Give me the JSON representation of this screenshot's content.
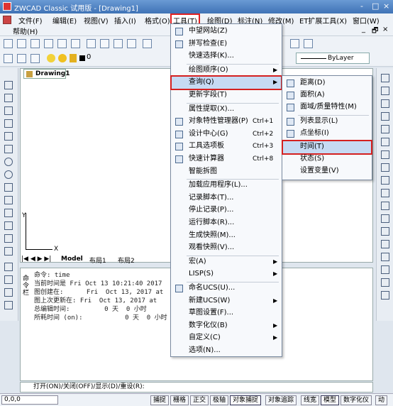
{
  "title": "ZWCAD Classic 试用版 - [Drawing1]",
  "window_controls": [
    "-",
    "□",
    "×"
  ],
  "doc_controls": [
    "_",
    "🗗",
    "×"
  ],
  "menubar": {
    "items": [
      "文件(F)",
      "编辑(E)",
      "视图(V)",
      "插入(I)",
      "格式(O)",
      "工具(T)",
      "绘图(D)",
      "标注(N)",
      "修改(M)",
      "ET扩展工具(X)",
      "窗口(W)"
    ],
    "help": "帮助(H)"
  },
  "bylayer": "ByLayer",
  "layer_value": "0",
  "doc_tab": "Drawing1",
  "model_tabs": [
    "Model",
    "布局1",
    "布局2"
  ],
  "command_history": [
    "命令: time",
    "当前时间是 Fri Oct 13 10:21:40 2017",
    "图创建在:      Fri  Oct 13, 2017 at",
    "图上次更新在: Fri  Oct 13, 2017 at",
    "总编辑时间:         0 天  0 小时",
    "所耗时间 (on):           0 天  0 小时"
  ],
  "command_side_label": "命\n令\n栏",
  "command_prompt": "打开(ON)/关闭(OFF)/显示(D)/重设(R):",
  "coordinates": "0,0,0",
  "status_buttons": [
    {
      "label": "捕捉",
      "on": false
    },
    {
      "label": "栅格",
      "on": false
    },
    {
      "label": "正交",
      "on": false
    },
    {
      "label": "极轴",
      "on": false
    },
    {
      "label": "对象捕捉",
      "on": true
    },
    {
      "label": "对象追踪",
      "on": false
    },
    {
      "label": "线宽",
      "on": false
    },
    {
      "label": "模型",
      "on": true
    },
    {
      "label": "数字化仪",
      "on": false
    },
    {
      "label": "动",
      "on": false
    }
  ],
  "ucs": {
    "x_label": "X",
    "y_label": "Y"
  },
  "tools_menu": {
    "items": [
      {
        "label": "中望网站(Z)",
        "icon": "globe-icon"
      },
      {
        "label": "拼写检查(E)",
        "icon": "spell-check-icon"
      },
      {
        "label": "快速选择(K)...",
        "icon": ""
      },
      {
        "label": "绘图顺序(O)",
        "icon": "",
        "submenu": true
      },
      {
        "label": "查询(Q)",
        "icon": "",
        "submenu": true,
        "highlight": true
      },
      {
        "label": "更新字段(T)",
        "icon": ""
      },
      {
        "label": "属性提取(X)...",
        "icon": ""
      },
      {
        "label": "对象特性管理器(P)",
        "icon": "properties-icon",
        "shortcut": "Ctrl+1"
      },
      {
        "label": "设计中心(G)",
        "icon": "design-center-icon",
        "shortcut": "Ctrl+2"
      },
      {
        "label": "工具选项板",
        "icon": "tool-palette-icon",
        "shortcut": "Ctrl+3"
      },
      {
        "label": "快速计算器",
        "icon": "calculator-icon",
        "shortcut": "Ctrl+8"
      },
      {
        "label": "智能拆图",
        "icon": ""
      },
      {
        "label": "加载应用程序(L)...",
        "icon": ""
      },
      {
        "label": "记录脚本(T)...",
        "icon": ""
      },
      {
        "label": "停止记录(P)...",
        "icon": ""
      },
      {
        "label": "运行脚本(R)...",
        "icon": ""
      },
      {
        "label": "生成快照(M)...",
        "icon": ""
      },
      {
        "label": "观看快照(V)...",
        "icon": ""
      },
      {
        "label": "宏(A)",
        "icon": "",
        "submenu": true
      },
      {
        "label": "LISP(S)",
        "icon": "",
        "submenu": true
      },
      {
        "label": "命名UCS(U)...",
        "icon": "ucs-icon"
      },
      {
        "label": "新建UCS(W)",
        "icon": "",
        "submenu": true
      },
      {
        "label": "草图设置(F)...",
        "icon": ""
      },
      {
        "label": "数字化仪(B)",
        "icon": "",
        "submenu": true
      },
      {
        "label": "自定义(C)",
        "icon": "",
        "submenu": true
      },
      {
        "label": "选项(N)...",
        "icon": ""
      }
    ]
  },
  "query_submenu": {
    "items": [
      {
        "label": "距离(D)",
        "icon": "distance-icon"
      },
      {
        "label": "面积(A)",
        "icon": "area-icon"
      },
      {
        "label": "面域/质量特性(M)",
        "icon": "mass-properties-icon"
      },
      {
        "label": "列表显示(L)",
        "icon": "list-icon"
      },
      {
        "label": "点坐标(I)",
        "icon": "point-coordinate-icon"
      },
      {
        "label": "时间(T)",
        "icon": "",
        "highlight": true
      },
      {
        "label": "状态(S)",
        "icon": ""
      },
      {
        "label": "设置变量(V)",
        "icon": ""
      }
    ]
  }
}
